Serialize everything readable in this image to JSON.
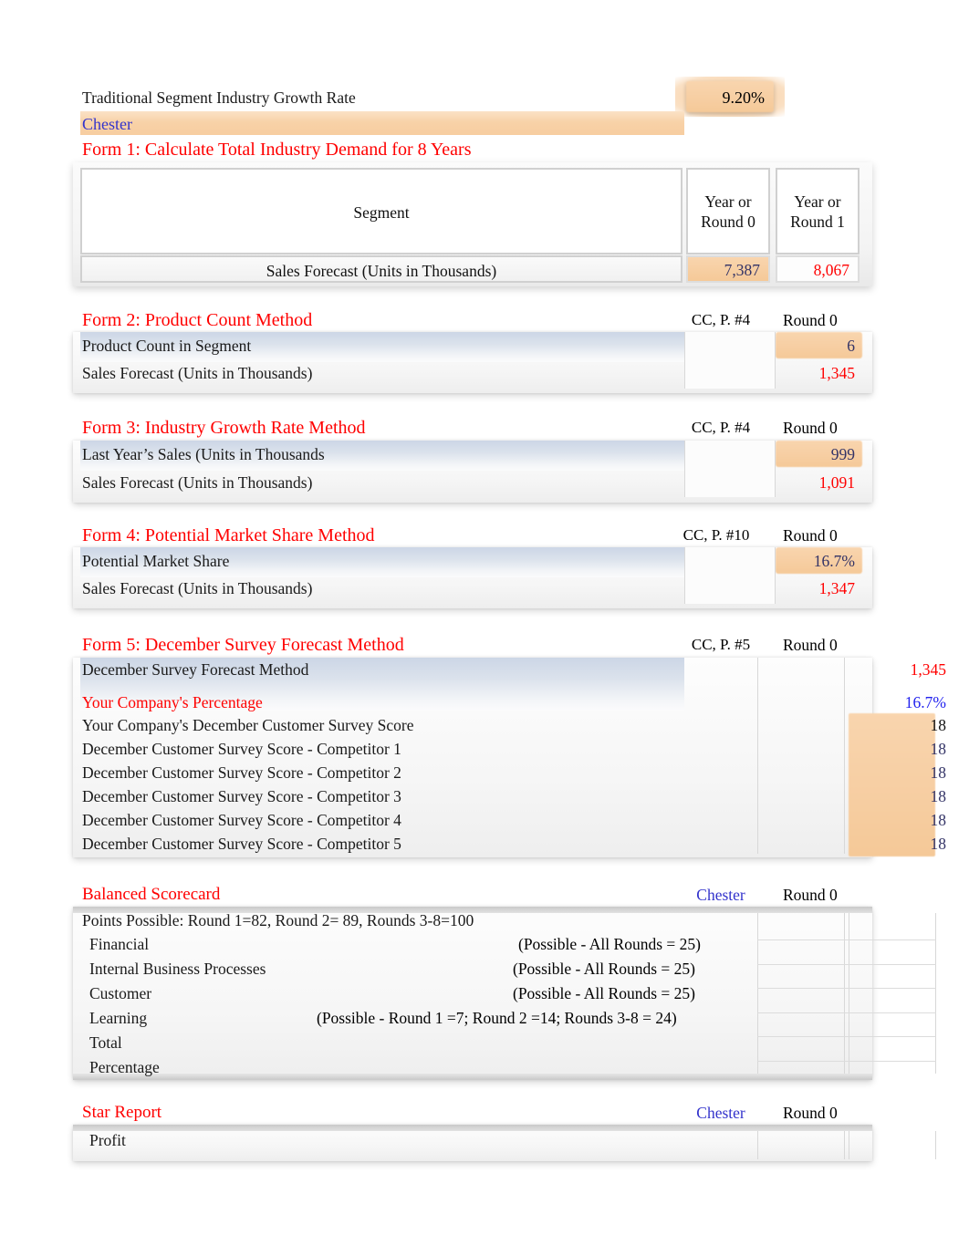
{
  "header": {
    "growth_rate_label": "Traditional Segment Industry Growth Rate",
    "growth_rate_value": "9.20%",
    "company": "Chester"
  },
  "form1": {
    "title": "Form 1: Calculate Total Industry Demand for 8 Years",
    "col_segment": "Segment",
    "col_round0": "Year or\nRound 0",
    "col_round0_line1": "Year or",
    "col_round0_line2": "Round 0",
    "col_round1_line1": "Year or",
    "col_round1_line2": "Round 1",
    "row_label": "Sales Forecast (Units in Thousands)",
    "round0_value": "7,387",
    "round1_value": "8,067"
  },
  "form2": {
    "title": "Form 2: Product Count Method",
    "ref": "CC, P. #4",
    "round_label": "Round 0",
    "rows": [
      {
        "label": "Product Count in Segment",
        "value": "6"
      },
      {
        "label": "Sales Forecast (Units in Thousands)",
        "value": "1,345"
      }
    ]
  },
  "form3": {
    "title": "Form 3: Industry Growth Rate Method",
    "ref": "CC, P. #4",
    "round_label": "Round 0",
    "rows": [
      {
        "label": "Last Year’s Sales (Units in Thousands",
        "value": "999"
      },
      {
        "label": "Sales Forecast (Units in Thousands)",
        "value": "1,091"
      }
    ]
  },
  "form4": {
    "title": "Form 4: Potential Market Share Method",
    "ref": "CC, P. #10",
    "round_label": "Round 0",
    "rows": [
      {
        "label": "Potential Market Share",
        "value": "16.7%"
      },
      {
        "label": "Sales Forecast (Units in Thousands)",
        "value": "1,347"
      }
    ]
  },
  "form5": {
    "title": "Form 5: December Survey Forecast Method",
    "ref": "CC, P. #5",
    "round_label": "Round 0",
    "row_forecast": {
      "label": "December Survey Forecast Method",
      "value": "1,345"
    },
    "row_percentage": {
      "label": "Your Company's Percentage",
      "value": "16.7%"
    },
    "scores": [
      {
        "label": "Your Company's December Customer Survey Score",
        "value": "18"
      },
      {
        "label": "December Customer Survey Score - Competitor 1",
        "value": "18"
      },
      {
        "label": "December Customer Survey Score - Competitor 2",
        "value": "18"
      },
      {
        "label": "December Customer Survey Score - Competitor 3",
        "value": "18"
      },
      {
        "label": "December Customer Survey Score - Competitor 4",
        "value": "18"
      },
      {
        "label": "December Customer Survey Score - Competitor 5",
        "value": "18"
      }
    ]
  },
  "scorecard": {
    "title": "Balanced Scorecard",
    "company": "Chester",
    "round_label": "Round 0",
    "points_possible": "Points Possible: Round 1=82, Round 2= 89, Rounds 3-8=100",
    "rows": [
      {
        "label": "Financial",
        "note": "(Possible - All Rounds = 25)",
        "value": ""
      },
      {
        "label": "Internal Business Processes",
        "note": "(Possible - All Rounds = 25)",
        "value": ""
      },
      {
        "label": "Customer",
        "note": "(Possible - All Rounds = 25)",
        "value": ""
      },
      {
        "label": "Learning",
        "note": "(Possible - Round 1 =7; Round 2 =14; Rounds 3-8 = 24)",
        "value": ""
      },
      {
        "label": "Total",
        "note": "",
        "value": ""
      },
      {
        "label": "Percentage",
        "note": "",
        "value": ""
      }
    ]
  },
  "star_report": {
    "title": "Star Report",
    "company": "Chester",
    "round_label": "Round 0",
    "rows": [
      {
        "label": "Profit",
        "value": ""
      }
    ]
  },
  "colors": {
    "accent_red": "#ff0000",
    "accent_blue": "#3333cc",
    "input_navy": "#333366",
    "highlight_orange": "#f7cfa4",
    "band_blue": "#ccd6e6"
  }
}
